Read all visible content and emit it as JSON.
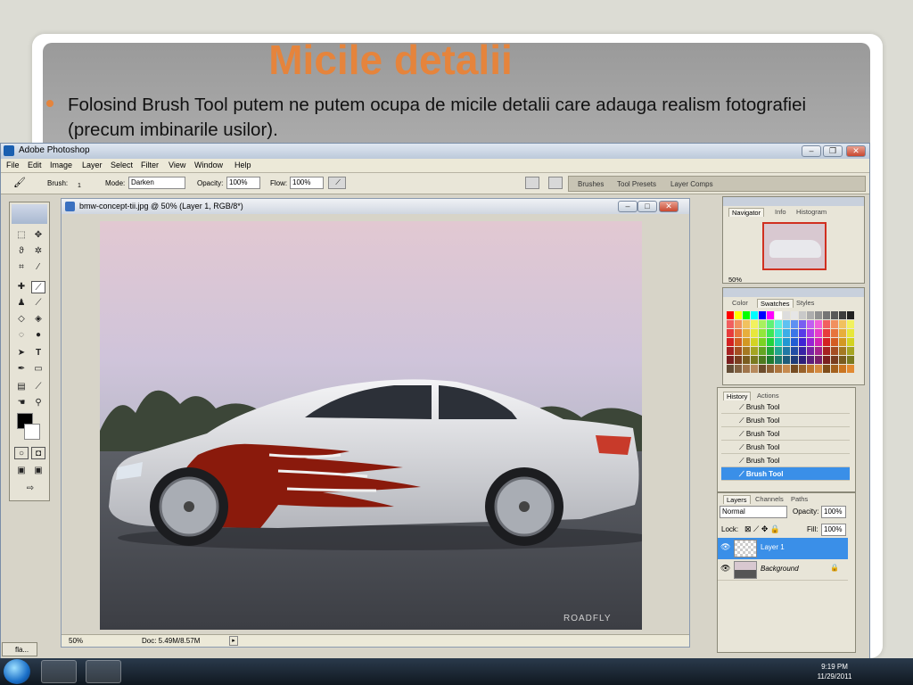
{
  "slide": {
    "title": "Micile detalii",
    "bullet": "Folosind Brush Tool putem ne putem ocupa de micile detalii care adauga realism fotografiei (precum imbinarile usilor)."
  },
  "photoshop": {
    "app_title": "Adobe Photoshop",
    "menu": [
      "File",
      "Edit",
      "Image",
      "Layer",
      "Select",
      "Filter",
      "View",
      "Window",
      "Help"
    ],
    "options": {
      "brush_label": "Brush:",
      "brush_size": "1",
      "mode_label": "Mode:",
      "mode_value": "Darken",
      "opacity_label": "Opacity:",
      "opacity_value": "100%",
      "flow_label": "Flow:",
      "flow_value": "100%"
    },
    "palette_well_tabs": [
      "Brushes",
      "Tool Presets",
      "Layer Comps"
    ],
    "document": {
      "title": "bmw-concept-tii.jpg @ 50% (Layer 1, RGB/8*)",
      "zoom": "50%",
      "doc_size": "Doc: 5.49M/8.57M",
      "watermark": "ROADFLY"
    },
    "navigator": {
      "tabs": [
        "Navigator",
        "Info",
        "Histogram"
      ],
      "zoom": "50%"
    },
    "swatches": {
      "tabs": [
        "Color",
        "Swatches",
        "Styles"
      ]
    },
    "history": {
      "tabs": [
        "History",
        "Actions"
      ],
      "items": [
        "Brush Tool",
        "Brush Tool",
        "Brush Tool",
        "Brush Tool",
        "Brush Tool",
        "Brush Tool"
      ]
    },
    "layers": {
      "tabs": [
        "Layers",
        "Channels",
        "Paths"
      ],
      "blend_mode": "Normal",
      "opacity_label": "Opacity:",
      "opacity_value": "100%",
      "lock_label": "Lock:",
      "fill_label": "Fill:",
      "fill_value": "100%",
      "items": [
        "Layer 1",
        "Background"
      ]
    },
    "minimized_doc": "fla..."
  },
  "taskbar": {
    "time": "9:19 PM",
    "date": "11/29/2011"
  },
  "colors": {
    "accent": "#e5843c",
    "selection": "#3a8fe8"
  },
  "icons": [
    "windows-start-icon",
    "photoshop-icon",
    "ie-icon",
    "brush-icon",
    "eye-icon",
    "lock-icon"
  ]
}
